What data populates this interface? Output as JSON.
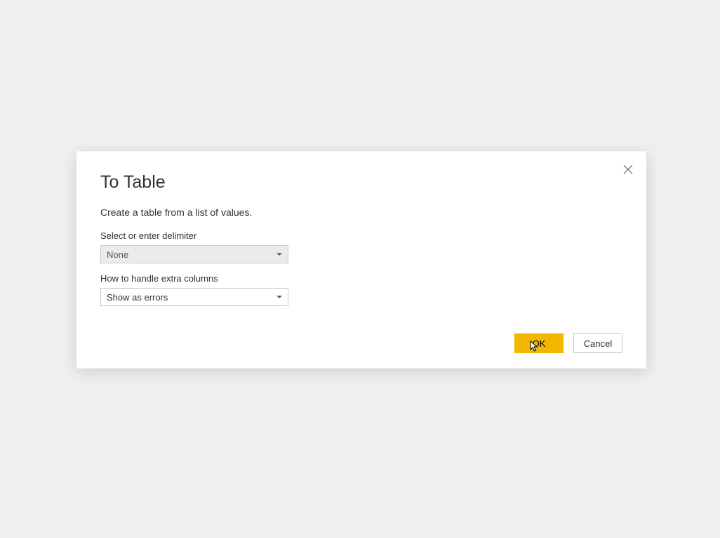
{
  "dialog": {
    "title": "To Table",
    "subtitle": "Create a table from a list of values.",
    "delimiter": {
      "label": "Select or enter delimiter",
      "value": "None"
    },
    "extraColumns": {
      "label": "How to handle extra columns",
      "value": "Show as errors"
    },
    "buttons": {
      "ok": "OK",
      "cancel": "Cancel"
    }
  }
}
